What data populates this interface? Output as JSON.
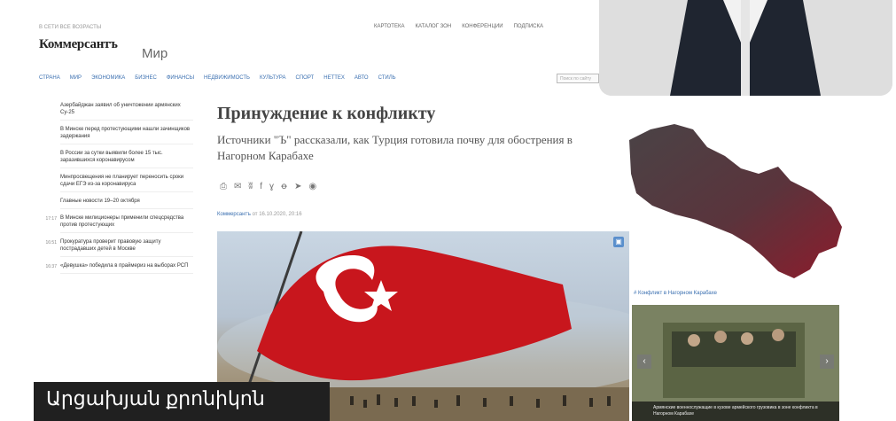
{
  "header": {
    "topline": "В СЕТИ ВСЕ ВОЗРАСТЫ",
    "logo": "Коммерсантъ",
    "section": "Мир",
    "top_links": [
      "КАРТОТЕКА",
      "КАТАЛОГ ЗОН",
      "КОНФЕРЕНЦИИ",
      "ПОДПИСКА"
    ]
  },
  "nav": {
    "items": [
      "СТРАНА",
      "МИР",
      "ЭКОНОМИКА",
      "БИЗНЕС",
      "ФИНАНСЫ",
      "НЕДВИЖИМОСТЬ",
      "КУЛЬТУРА",
      "СПОРТ",
      "НЕТТЕХ",
      "АВТО",
      "СТИЛЬ"
    ],
    "search_placeholder": "Поиск по сайту"
  },
  "sidebar": {
    "items": [
      {
        "time": "",
        "text": "Азербайджан заявил об уничтожении армянских Су-25"
      },
      {
        "time": "",
        "text": "В Минске перед протестующими нашли зачинщиков задержания"
      },
      {
        "time": "",
        "text": "В России за сутки выявили более 15 тыс. заразившихся коронавирусом"
      },
      {
        "time": "",
        "text": "Минпросвещения не планирует переносить сроки сдачи ЕГЭ из-за коронавируса"
      },
      {
        "time": "",
        "text": "Главные новости 19–20 октября"
      },
      {
        "time": "17:17",
        "text": "В Минске милиционеры применили спецсредства против протестующих"
      },
      {
        "time": "16:51",
        "text": "Прокуратура проверит правовую защиту пострадавших детей в Москве"
      },
      {
        "time": "16:37",
        "text": "«Девушка» победила в праймериз на выборах РСП"
      }
    ]
  },
  "article": {
    "title": "Принуждение к конфликту",
    "subtitle": "Источники \"Ъ\" рассказали, как Турция готовила почву для обострения в Нагорном Карабахе",
    "share_icons": [
      "print-icon",
      "comment-icon",
      "vk-icon",
      "facebook-icon",
      "twitter-icon",
      "ok-icon",
      "telegram-icon",
      "whatsapp-icon"
    ],
    "byline_source": "Коммерсантъ",
    "byline_date": "от 16.10.2020, 20:16"
  },
  "right": {
    "map_caption": "# Конфликт в Нагорном Карабахе",
    "gallery_caption": "Армянские военнослужащие в кузове армейского грузовика в зоне конфликта в Нагорном Карабахе"
  },
  "overlay": {
    "banner_text": "Արցախյան քրոնիկոն"
  },
  "colors": {
    "link": "#3a6fb0",
    "flag_red": "#c8161d",
    "map_dark": "#4a4346",
    "map_red": "#8c1c2c",
    "banner_bg": "#202020"
  }
}
